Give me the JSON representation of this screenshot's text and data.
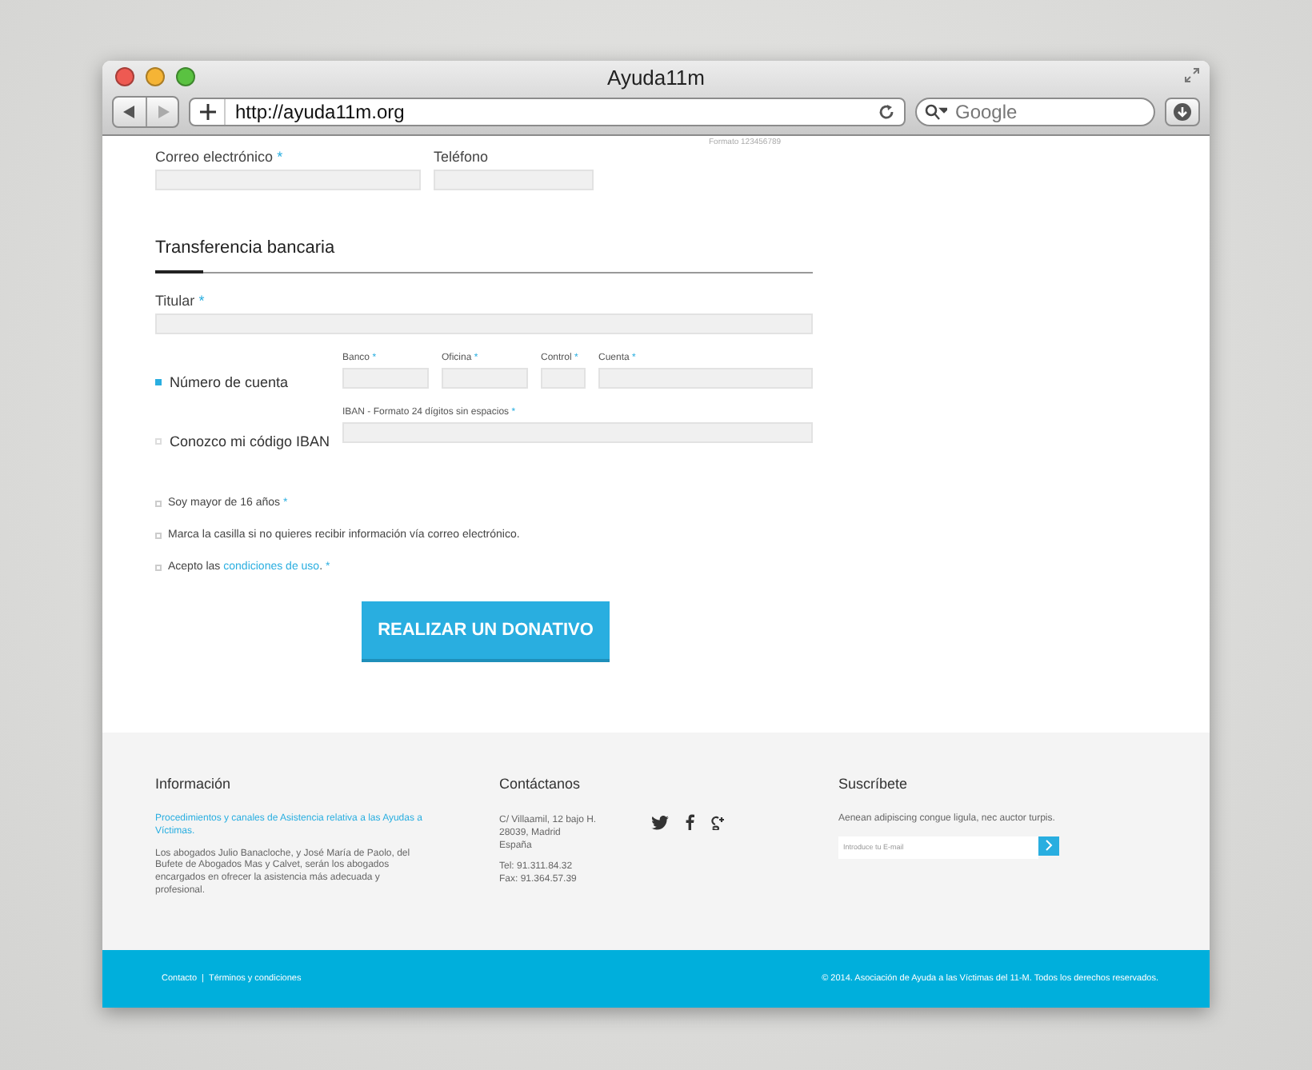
{
  "window": {
    "title": "Ayuda11m",
    "url": "http://ayuda11m.org",
    "search": {
      "placeholder": "Google"
    }
  },
  "form": {
    "phone_hint": "Formato 123456789",
    "contact_fields": [
      {
        "label": "Correo electrónico",
        "mark": "*"
      },
      {
        "label": "Teléfono"
      }
    ],
    "section_title": "Transferencia bancaria",
    "holder": {
      "label": "Titular",
      "mark": "*"
    },
    "account_options": [
      {
        "label": "Número de cuenta",
        "selected": true,
        "fields": [
          {
            "label": "Banco",
            "mark": "*"
          },
          {
            "label": "Oficina",
            "mark": "*"
          },
          {
            "label": "Control",
            "mark": "*"
          },
          {
            "label": "Cuenta",
            "mark": "*"
          }
        ]
      },
      {
        "label": "Conozco mi código IBAN",
        "selected": false,
        "fields": [
          {
            "label": "IBAN - Formato 24 dígitos sin espacios",
            "mark": "*"
          }
        ]
      }
    ],
    "checkboxes": [
      {
        "text": "Soy mayor de 16 años",
        "mark": "*",
        "checked": false
      },
      {
        "text": "Marca la casilla si no quieres recibir información vía correo electrónico.",
        "checked": false
      },
      {
        "text": "Acepto las",
        "link": "condiciones de uso",
        "after_link": ".",
        "mark": "*",
        "checked": false
      }
    ],
    "submit": "REALIZAR UN DONATIVO"
  },
  "footer": {
    "info": {
      "title": "Información",
      "link": "Procedimientos y canales de Asistencia relativa a las Ayudas a Víctimas.",
      "text": "Los abogados Julio Banacloche, y José María de Paolo, del Bufete de Abogados Mas y Calvet, serán los abogados encargados en ofrecer la asistencia más adecuada y profesional."
    },
    "contact": {
      "title": "Contáctanos",
      "address": [
        "C/ Villaamil, 12 bajo H.",
        "28039, Madrid",
        "España"
      ],
      "phones": [
        "Tel: 91.311.84.32",
        "Fax: 91.364.57.39"
      ]
    },
    "subscribe": {
      "title": "Suscríbete",
      "text": "Aenean adipiscing congue ligula, nec auctor turpis.",
      "placeholder": "Introduce tu E-mail"
    }
  },
  "bottom_bar": {
    "links": [
      "Contacto",
      "Términos y condiciones"
    ],
    "separator": "|",
    "copyright": "© 2014. Asociación de Ayuda a las Víctimas del 11-M. Todos los derechos reservados."
  }
}
